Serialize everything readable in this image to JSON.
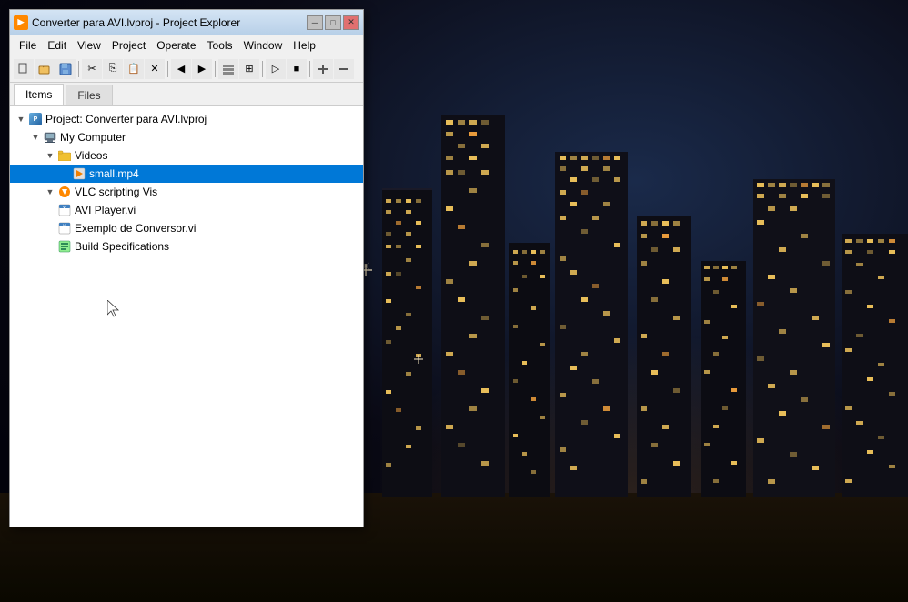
{
  "window": {
    "title": "Converter para AVI.lvproj - Project Explorer",
    "icon": "◈"
  },
  "titlebar": {
    "minimize": "─",
    "maximize": "□",
    "close": "✕"
  },
  "menu": {
    "items": [
      "File",
      "Edit",
      "View",
      "Project",
      "Operate",
      "Tools",
      "Window",
      "Help"
    ]
  },
  "tabs": {
    "items": [
      "Items",
      "Files"
    ],
    "active": 0
  },
  "tree": {
    "items": [
      {
        "id": "project",
        "label": "Project: Converter para AVI.lvproj",
        "indent": 0,
        "icon": "project",
        "expand": "▼",
        "selected": false
      },
      {
        "id": "computer",
        "label": "My Computer",
        "indent": 1,
        "icon": "computer",
        "expand": "▼",
        "selected": false
      },
      {
        "id": "videos",
        "label": "Videos",
        "indent": 2,
        "icon": "folder",
        "expand": "▼",
        "selected": false
      },
      {
        "id": "small_mp4",
        "label": "small.mp4",
        "indent": 3,
        "icon": "video",
        "expand": "",
        "selected": true
      },
      {
        "id": "vlc",
        "label": "VLC scripting Vis",
        "indent": 2,
        "icon": "vlc",
        "expand": "▼",
        "selected": false
      },
      {
        "id": "avi_player",
        "label": "AVI Player.vi",
        "indent": 2,
        "icon": "vi",
        "expand": "",
        "selected": false
      },
      {
        "id": "conversor",
        "label": "Exemplo de Conversor.vi",
        "indent": 2,
        "icon": "vi",
        "expand": "",
        "selected": false
      },
      {
        "id": "build",
        "label": "Build Specifications",
        "indent": 2,
        "icon": "build",
        "expand": "",
        "selected": false
      }
    ]
  }
}
